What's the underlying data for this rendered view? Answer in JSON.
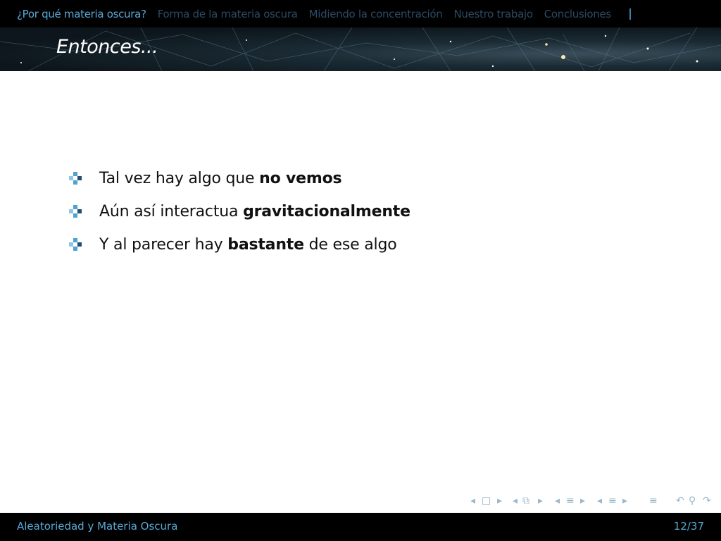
{
  "nav": {
    "sections": [
      "¿Por qué materia oscura?",
      "Forma de la materia oscura",
      "Midiendo la concentración",
      "Nuestro trabajo",
      "Conclusiones"
    ]
  },
  "slide": {
    "title": "Entonces...",
    "items": [
      {
        "pre": "Tal vez hay algo que ",
        "bold": "no vemos",
        "post": ""
      },
      {
        "pre": "Aún así interactua ",
        "bold": "gravitacionalmente",
        "post": ""
      },
      {
        "pre": "Y al parecer hay ",
        "bold": "bastante",
        "post": " de ese algo"
      }
    ]
  },
  "footer": {
    "title": "Aleatoriedad y Materia Oscura",
    "page": "12/37"
  },
  "colors": {
    "accent": "#5aa8d6",
    "bullet_light": "#4fa3cf",
    "bullet_dark": "#1f4e70"
  }
}
